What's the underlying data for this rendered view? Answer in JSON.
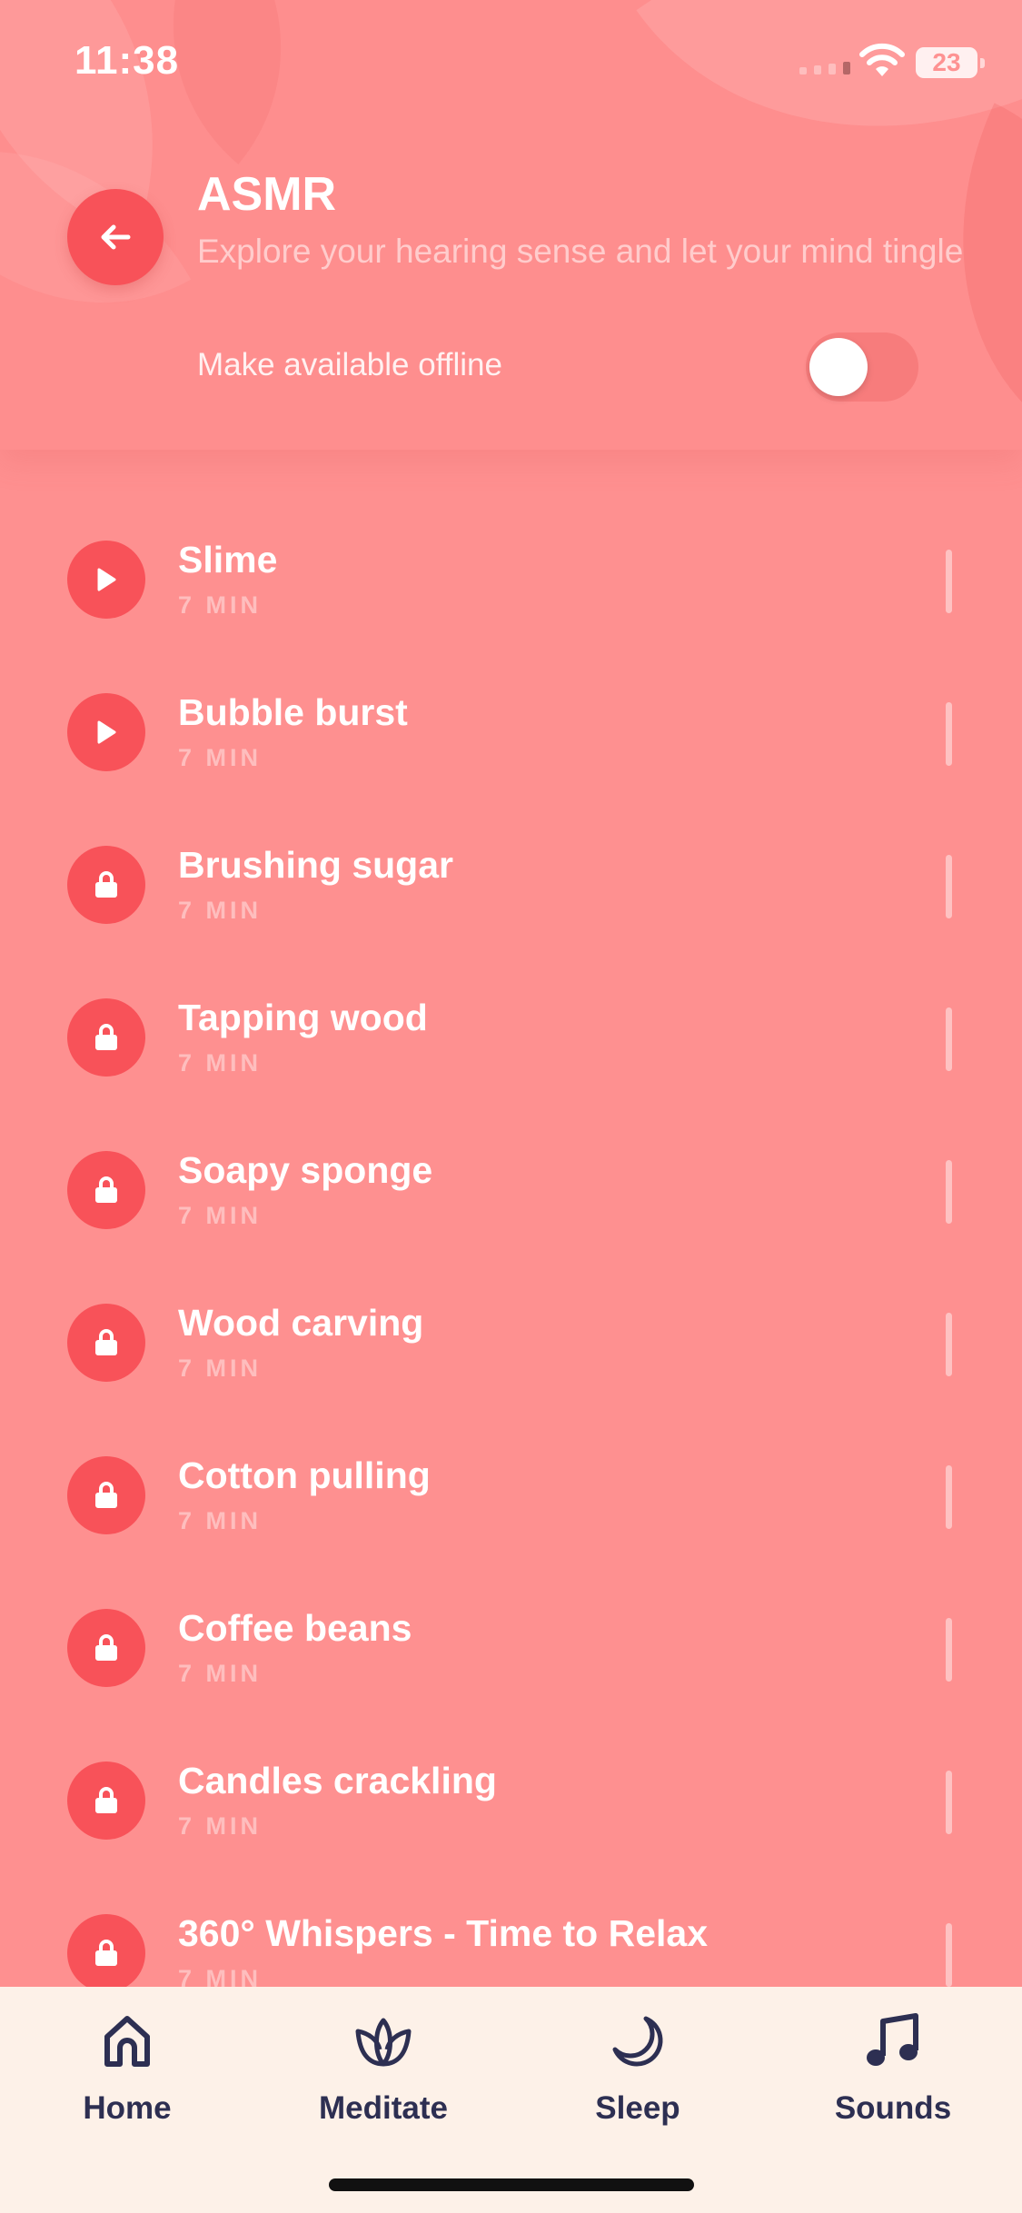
{
  "status": {
    "time": "11:38",
    "battery": "23"
  },
  "header": {
    "title": "ASMR",
    "subtitle": "Explore your hearing sense and let your mind tingle",
    "offline_label": "Make available offline",
    "offline_enabled": false
  },
  "tracks": [
    {
      "name": "Slime",
      "duration": "7 MIN",
      "icon": "play-icon"
    },
    {
      "name": "Bubble burst",
      "duration": "7 MIN",
      "icon": "play-icon"
    },
    {
      "name": "Brushing sugar",
      "duration": "7 MIN",
      "icon": "lock-icon"
    },
    {
      "name": "Tapping wood",
      "duration": "7 MIN",
      "icon": "lock-icon"
    },
    {
      "name": "Soapy sponge",
      "duration": "7 MIN",
      "icon": "lock-icon"
    },
    {
      "name": "Wood carving",
      "duration": "7 MIN",
      "icon": "lock-icon"
    },
    {
      "name": "Cotton pulling",
      "duration": "7 MIN",
      "icon": "lock-icon"
    },
    {
      "name": "Coffee beans",
      "duration": "7 MIN",
      "icon": "lock-icon"
    },
    {
      "name": "Candles crackling",
      "duration": "7 MIN",
      "icon": "lock-icon"
    },
    {
      "name": "360° Whispers - Time to Relax",
      "duration": "7 MIN",
      "icon": "lock-icon"
    }
  ],
  "tabs": [
    {
      "label": "Home",
      "icon": "home-icon"
    },
    {
      "label": "Meditate",
      "icon": "lotus-icon"
    },
    {
      "label": "Sleep",
      "icon": "moon-icon"
    },
    {
      "label": "Sounds",
      "icon": "music-note-icon"
    }
  ],
  "colors": {
    "accent": "#f85259",
    "background": "#fe9090",
    "tabbar": "#fdf1e8",
    "tab_text": "#2d2f52"
  }
}
